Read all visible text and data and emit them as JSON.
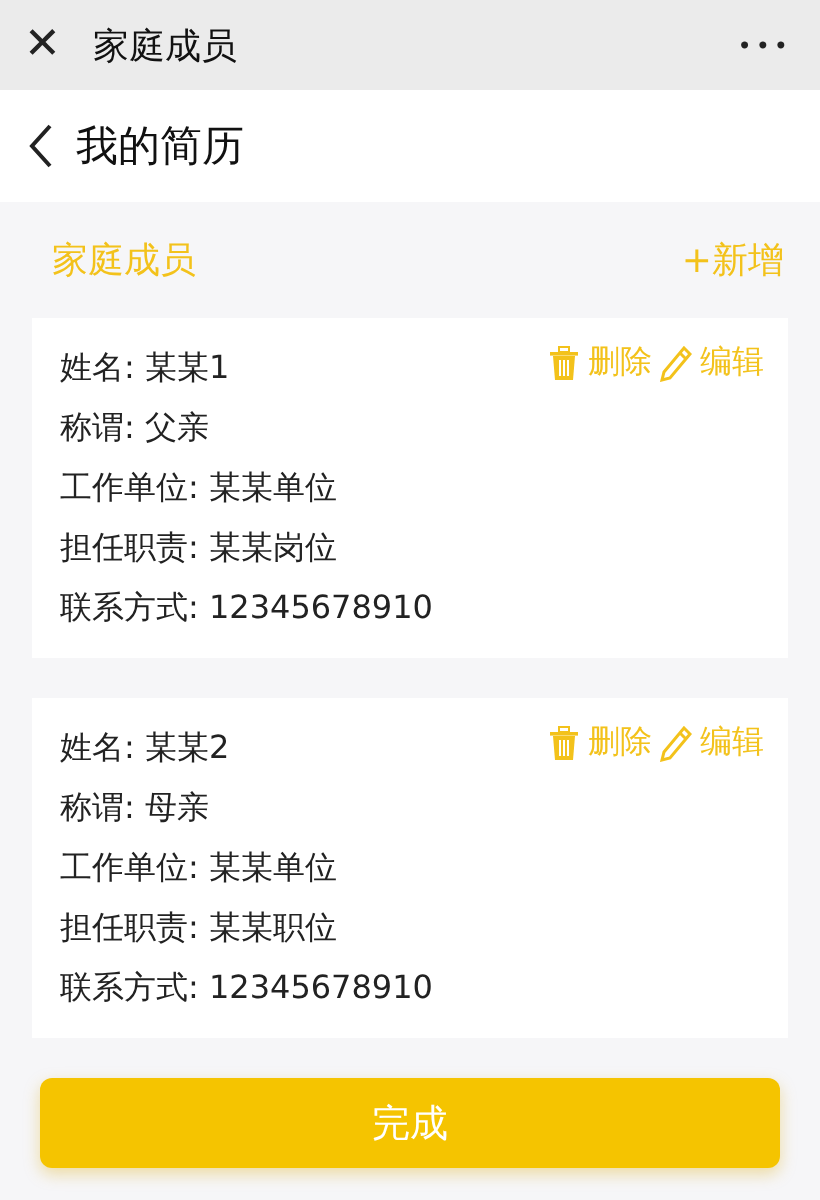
{
  "window": {
    "title": "家庭成员",
    "close_icon": "✕",
    "more_icon": "•••"
  },
  "nav": {
    "title": "我的简历"
  },
  "section": {
    "title": "家庭成员",
    "add": "+新增"
  },
  "members": [
    {
      "lines": [
        "姓名: 某某1",
        "称谓: 父亲",
        "工作单位: 某某单位",
        "担任职责: 某某岗位",
        "联系方式: 12345678910"
      ],
      "delete": "删除",
      "edit": "编辑"
    },
    {
      "lines": [
        "姓名: 某某2",
        "称谓: 母亲",
        "工作单位: 某某单位",
        "担任职责: 某某职位",
        "联系方式: 12345678910"
      ],
      "delete": "删除",
      "edit": "编辑"
    }
  ],
  "done_button": "完成"
}
